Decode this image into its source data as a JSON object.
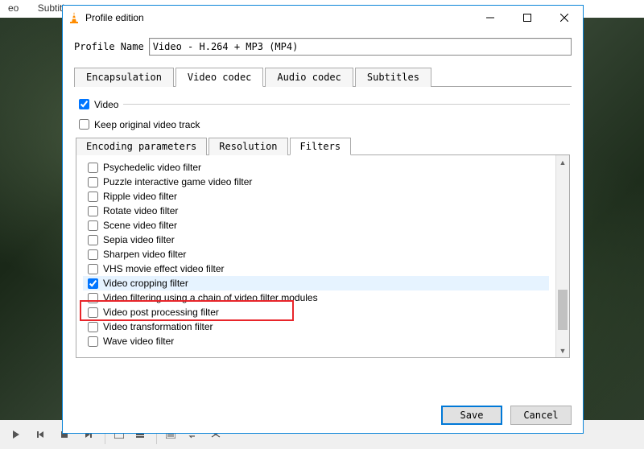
{
  "bg_menu": {
    "item0": "eo",
    "item1": "Subtitle"
  },
  "dialog": {
    "title": "Profile edition",
    "profile_name_label": "Profile Name",
    "profile_name_value": "Video - H.264 + MP3 (MP4)",
    "tabs_outer": {
      "encapsulation": "Encapsulation",
      "video_codec": "Video codec",
      "audio_codec": "Audio codec",
      "subtitles": "Subtitles"
    },
    "video_checkbox_label": "Video",
    "keep_original_label": "Keep original video track",
    "tabs_inner": {
      "encoding": "Encoding parameters",
      "resolution": "Resolution",
      "filters": "Filters"
    },
    "filters": [
      {
        "label": "Psychedelic video filter",
        "checked": false
      },
      {
        "label": "Puzzle interactive game video filter",
        "checked": false
      },
      {
        "label": "Ripple video filter",
        "checked": false
      },
      {
        "label": "Rotate video filter",
        "checked": false
      },
      {
        "label": "Scene video filter",
        "checked": false
      },
      {
        "label": "Sepia video filter",
        "checked": false
      },
      {
        "label": "Sharpen video filter",
        "checked": false
      },
      {
        "label": "VHS movie effect video filter",
        "checked": false
      },
      {
        "label": "Video cropping filter",
        "checked": true,
        "selected": true
      },
      {
        "label": "Video filtering using a chain of video filter modules",
        "checked": false
      },
      {
        "label": "Video post processing filter",
        "checked": false
      },
      {
        "label": "Video transformation filter",
        "checked": false
      },
      {
        "label": "Wave video filter",
        "checked": false
      }
    ],
    "buttons": {
      "save": "Save",
      "cancel": "Cancel"
    }
  }
}
